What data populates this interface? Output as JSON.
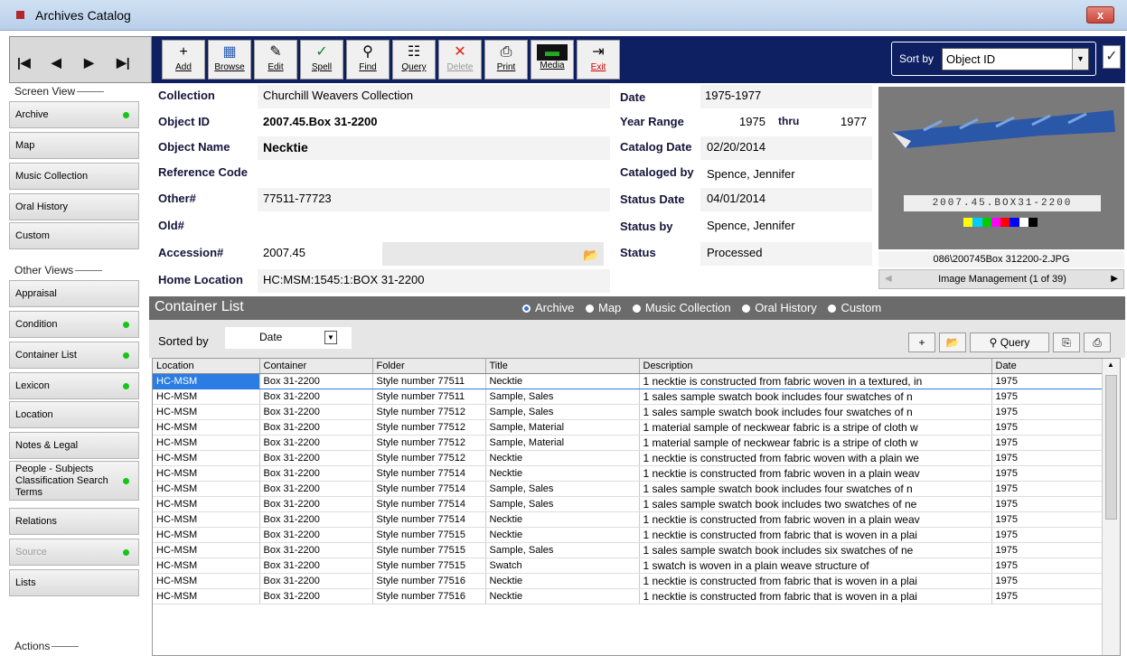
{
  "window": {
    "title": "Archives Catalog",
    "close_label": "x"
  },
  "toolbar": {
    "nav": [
      "|◀",
      "◀",
      "▶",
      "▶|"
    ],
    "buttons": [
      {
        "label": "Add",
        "icon": "+"
      },
      {
        "label": "Browse",
        "icon": "▦"
      },
      {
        "label": "Edit",
        "icon": "✎"
      },
      {
        "label": "Spell",
        "icon": "✓"
      },
      {
        "label": "Find",
        "icon": "⚲"
      },
      {
        "label": "Query",
        "icon": "☷"
      },
      {
        "label": "Delete",
        "icon": "✕"
      },
      {
        "label": "Print",
        "icon": "⎙"
      },
      {
        "label": "Media",
        "icon": "▬"
      },
      {
        "label": "Exit",
        "icon": "⇥"
      }
    ],
    "sort_label": "Sort by",
    "sort_value": "Object ID"
  },
  "sidebar": {
    "screen_view_heading": "Screen View",
    "screen_view": [
      {
        "label": "Archive",
        "dot": true
      },
      {
        "label": "Map",
        "dot": false
      },
      {
        "label": "Music Collection",
        "dot": false
      },
      {
        "label": "Oral History",
        "dot": false
      },
      {
        "label": "Custom",
        "dot": false
      }
    ],
    "other_views_heading": "Other Views",
    "other_views": [
      {
        "label": "Appraisal",
        "dot": false
      },
      {
        "label": "Condition",
        "dot": true
      },
      {
        "label": "Container List",
        "dot": true
      },
      {
        "label": "Lexicon",
        "dot": true
      },
      {
        "label": "Location",
        "dot": false
      },
      {
        "label": "Notes & Legal",
        "dot": false
      },
      {
        "label": "People - Subjects Classification Search Terms",
        "dot": true
      },
      {
        "label": "Relations",
        "dot": false
      },
      {
        "label": "Source",
        "dot": true
      },
      {
        "label": "Lists",
        "dot": false
      }
    ],
    "actions_heading": "Actions"
  },
  "record": {
    "collection_label": "Collection",
    "collection": "Churchill Weavers Collection",
    "object_id_label": "Object ID",
    "object_id": "2007.45.Box 31-2200",
    "object_name_label": "Object Name",
    "object_name": "Necktie",
    "reference_code_label": "Reference Code",
    "reference_code": "",
    "other_label": "Other#",
    "other": "77511-77723",
    "old_label": "Old#",
    "old": "",
    "accession_label": "Accession#",
    "accession": "2007.45",
    "home_location_label": "Home Location",
    "home_location": "HC:MSM:1545:1:BOX 31-2200",
    "date_label": "Date",
    "date": "1975-1977",
    "year_range_label": "Year Range",
    "year_from": "1975",
    "year_thru_label": "thru",
    "year_to": "1977",
    "catalog_date_label": "Catalog Date",
    "catalog_date": "02/20/2014",
    "cataloged_by_label": "Cataloged by",
    "cataloged_by": "Spence, Jennifer",
    "status_date_label": "Status Date",
    "status_date": "04/01/2014",
    "status_by_label": "Status by",
    "status_by": "Spence, Jennifer",
    "status_label": "Status",
    "status": "Processed"
  },
  "image": {
    "tag_text": "2007.45.BOX31-2200",
    "filename": "086\\200745Box 312200-2.JPG",
    "manager_label": "Image Management (1 of 39)"
  },
  "container_list": {
    "title": "Container List",
    "views": [
      "Archive",
      "Map",
      "Music Collection",
      "Oral History",
      "Custom"
    ],
    "selected_view": "Archive",
    "sorted_by_label": "Sorted by",
    "sorted_by_value": "Date",
    "query_label": "Query",
    "columns": [
      "Location",
      "Container",
      "Folder",
      "Title",
      "Description",
      "Date"
    ],
    "rows": [
      [
        "HC-MSM",
        "Box 31-2200",
        "Style number 77511",
        "Necktie",
        "1 necktie is constructed from fabric woven in a textured, in",
        "1975"
      ],
      [
        "HC-MSM",
        "Box 31-2200",
        "Style number 77511",
        "Sample, Sales",
        "1 sales sample swatch book includes four swatches of n",
        "1975"
      ],
      [
        "HC-MSM",
        "Box 31-2200",
        "Style number 77512",
        "Sample, Sales",
        "1 sales sample swatch book includes four swatches of n",
        "1975"
      ],
      [
        "HC-MSM",
        "Box 31-2200",
        "Style number 77512",
        "Sample, Material",
        "1 material sample of neckwear fabric is a stripe of cloth w",
        "1975"
      ],
      [
        "HC-MSM",
        "Box 31-2200",
        "Style number 77512",
        "Sample, Material",
        "1 material sample of neckwear fabric is a stripe of cloth w",
        "1975"
      ],
      [
        "HC-MSM",
        "Box 31-2200",
        "Style number 77512",
        "Necktie",
        "1 necktie is constructed from fabric woven with a plain we",
        "1975"
      ],
      [
        "HC-MSM",
        "Box 31-2200",
        "Style number 77514",
        "Necktie",
        "1 necktie is constructed from fabric woven in a plain weav",
        "1975"
      ],
      [
        "HC-MSM",
        "Box 31-2200",
        "Style number 77514",
        "Sample, Sales",
        "1 sales sample swatch book includes four swatches of n",
        "1975"
      ],
      [
        "HC-MSM",
        "Box 31-2200",
        "Style number 77514",
        "Sample, Sales",
        "1 sales sample swatch book includes two swatches of ne",
        "1975"
      ],
      [
        "HC-MSM",
        "Box 31-2200",
        "Style number 77514",
        "Necktie",
        "1 necktie is constructed from fabric woven in a plain weav",
        "1975"
      ],
      [
        "HC-MSM",
        "Box 31-2200",
        "Style number 77515",
        "Necktie",
        "1 necktie is constructed from fabric that is woven in a plai",
        "1975"
      ],
      [
        "HC-MSM",
        "Box 31-2200",
        "Style number 77515",
        "Sample, Sales",
        "1 sales sample swatch book includes six swatches of ne",
        "1975"
      ],
      [
        "HC-MSM",
        "Box 31-2200",
        "Style number 77515",
        "Swatch",
        "1 swatch is woven in a plain weave structure of",
        "1975"
      ],
      [
        "HC-MSM",
        "Box 31-2200",
        "Style number 77516",
        "Necktie",
        "1 necktie is constructed from fabric that is woven in a plai",
        "1975"
      ],
      [
        "HC-MSM",
        "Box 31-2200",
        "Style number 77516",
        "Necktie",
        "1 necktie is constructed from fabric that is woven in a plai",
        "1975"
      ]
    ]
  }
}
